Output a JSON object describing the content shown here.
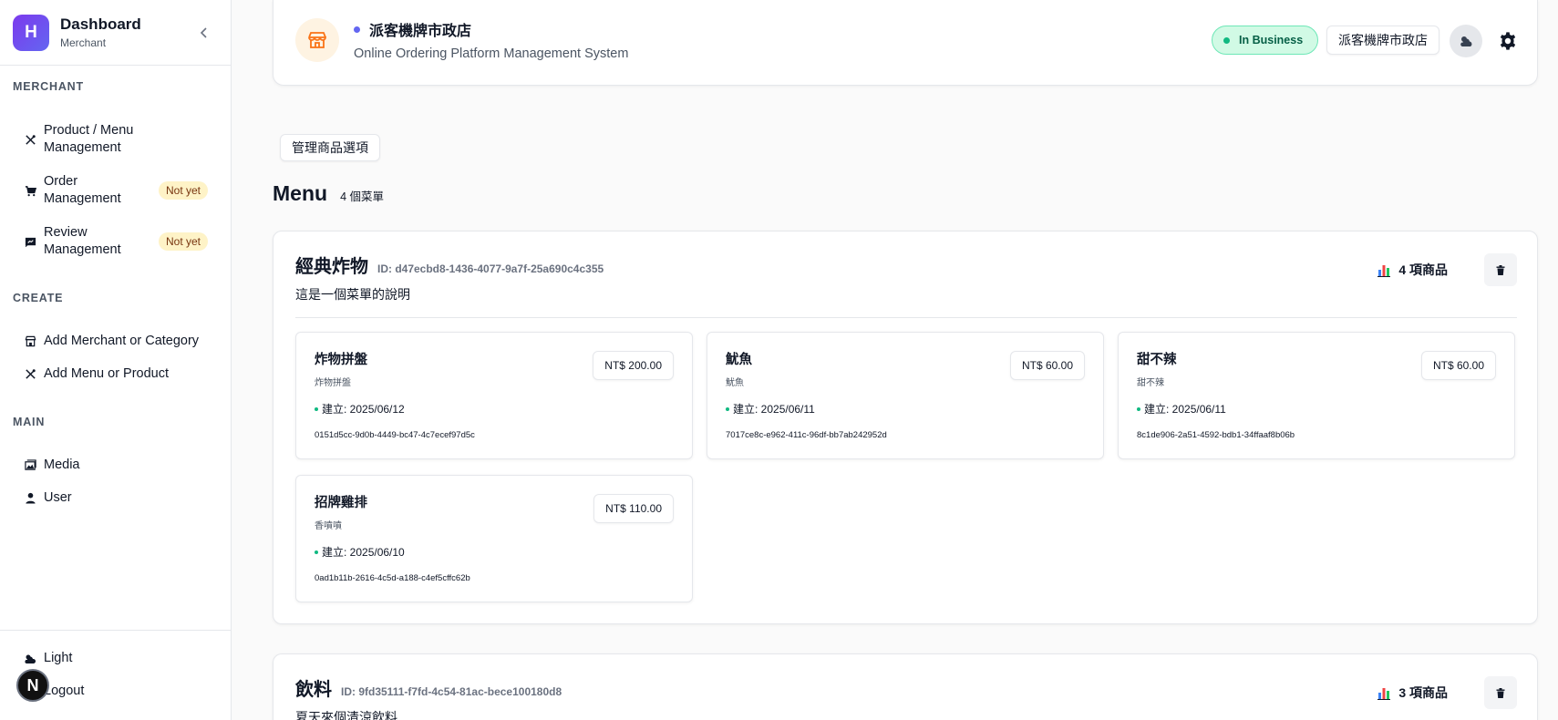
{
  "brand": {
    "logo_letter": "H",
    "title": "Dashboard",
    "subtitle": "Merchant"
  },
  "sidebar": {
    "sections": [
      {
        "label": "MERCHANT"
      },
      {
        "label": "CREATE"
      },
      {
        "label": "MAIN"
      }
    ],
    "merchant_items": [
      {
        "label": "Product / Menu Management",
        "icon": "utensils-icon"
      },
      {
        "label": "Order Management",
        "icon": "cart-icon",
        "badge": "Not yet"
      },
      {
        "label": "Review Management",
        "icon": "review-icon",
        "badge": "Not yet"
      }
    ],
    "create_items": [
      {
        "label": "Add Merchant or Category",
        "icon": "store-icon"
      },
      {
        "label": "Add Menu or Product",
        "icon": "utensils-icon"
      }
    ],
    "main_items": [
      {
        "label": "Media",
        "icon": "images-icon"
      },
      {
        "label": "User",
        "icon": "user-icon"
      }
    ],
    "footer_items": [
      {
        "label": "Light",
        "icon": "cloud-sun-icon"
      },
      {
        "label": "Logout",
        "icon": "logout-icon"
      }
    ]
  },
  "header": {
    "store_name": "派客機牌市政店",
    "store_subtitle": "Online Ordering Platform Management System",
    "status": "In Business",
    "store_button": "派客機牌市政店"
  },
  "manage_button": "管理商品選項",
  "menu_section": {
    "title": "Menu",
    "count": "4 個菜單"
  },
  "menus": [
    {
      "title": "經典炸物",
      "id": "ID: d47ecbd8-1436-4077-9a7f-25a690c4c355",
      "description": "這是一個菜單的說明",
      "count": "4 項商品",
      "products": [
        {
          "name": "炸物拼盤",
          "sub": "炸物拼盤",
          "price": "NT$ 200.00",
          "date": "建立: 2025/06/12",
          "id": "0151d5cc-9d0b-4449-bc47-4c7ecef97d5c"
        },
        {
          "name": "魷魚",
          "sub": "魷魚",
          "price": "NT$ 60.00",
          "date": "建立: 2025/06/11",
          "id": "7017ce8c-e962-411c-96df-bb7ab242952d"
        },
        {
          "name": "甜不辣",
          "sub": "甜不辣",
          "price": "NT$ 60.00",
          "date": "建立: 2025/06/11",
          "id": "8c1de906-2a51-4592-bdb1-34ffaaf8b06b"
        },
        {
          "name": "招牌雞排",
          "sub": "香噴噴",
          "price": "NT$ 110.00",
          "date": "建立: 2025/06/10",
          "id": "0ad1b11b-2616-4c5d-a188-c4ef5cffc62b"
        }
      ]
    },
    {
      "title": "飲料",
      "id": "ID: 9fd35111-f7fd-4c54-81ac-bece100180d8",
      "description": "夏天來個清涼飲料",
      "count": "3 項商品"
    }
  ],
  "fab_letter": "N",
  "colors": {
    "accent": "#6366f1",
    "status_green": "#10b981",
    "badge_yellow": "#fef3c7"
  }
}
